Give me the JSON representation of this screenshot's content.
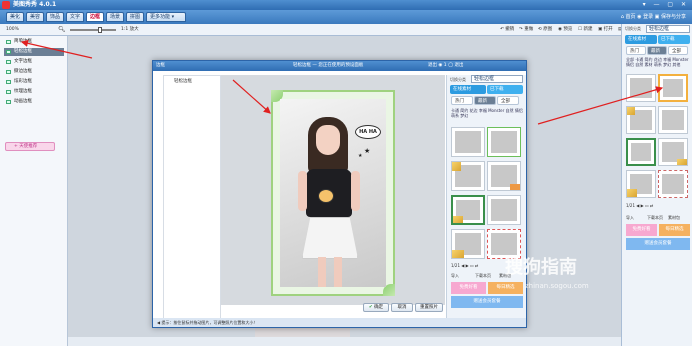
{
  "app": {
    "title": "美图秀秀 4.0.1",
    "window_controls": "▾ — ▢ ✕"
  },
  "menu": {
    "tabs": [
      "美化",
      "美容",
      "饰品",
      "文字",
      "边框",
      "场景",
      "拼图",
      "更多功能 ▾"
    ],
    "active_tab_index": 4,
    "right": "⌂ 首页   ◉ 登录  ▣ 保存与分享"
  },
  "toolbar": {
    "left_label": "100%",
    "zoom_label": "1:1  放大",
    "right_items": [
      "↶ 撤销",
      "↷ 重做",
      "⟲ 原图",
      "◉ 预览",
      "☐ 新建",
      "▣ 打开",
      "▤ 保存"
    ]
  },
  "sidebar": {
    "items": [
      "简单边框",
      "轻松边框",
      "文字边框",
      "撕边边框",
      "炫彩边框",
      "纹理边框",
      "动画边框"
    ],
    "active_index": 1,
    "recommend": "+ 天使推荐"
  },
  "right_panel": {
    "header": "轻松边框",
    "subheader_left": "在线素材",
    "subheader_right": "已下载",
    "tabs": [
      "热门",
      "最新",
      "全部"
    ],
    "categories": [
      "全部",
      "卡通",
      "简约",
      "花边",
      "幸福",
      "Monster",
      "情侣",
      "自然",
      "素材",
      "萌系",
      "梦幻",
      "其他"
    ],
    "page": "1/21",
    "bottom_buttons": [
      "导入",
      "下载本页",
      "素材包"
    ],
    "banners": [
      "免费好看",
      "每日精选",
      "赠送会员套餐"
    ]
  },
  "dialog": {
    "icon_label": "边框",
    "title": "轻松边框 — 您正在使用的预设面板",
    "title_right": "退出  ◉ 1  ◯ 退出",
    "list_item": "轻松边框",
    "right_header": "轻松边框",
    "right_sub_left": "在线素材",
    "right_sub_right": "已下载",
    "right_tabs": [
      "热门",
      "最新",
      "全部"
    ],
    "page": "1/21",
    "banners": [
      "免费好看",
      "每日精选",
      "赠送会员套餐"
    ],
    "bottom_buttons": [
      "导入",
      "下载本页",
      "素材包"
    ],
    "status": "◀ 提示：按住鼠标并拖动图片，可调整照片位置和大小！",
    "ok_label": "确定",
    "cancel_label": "取消",
    "reset_label": "重置照片"
  },
  "photo": {
    "speech_bubble": "HA HA"
  },
  "watermark": {
    "main": "搜狗指南",
    "sub": "zhinan.sogou.com"
  },
  "colors": {
    "accent": "#2f6db3",
    "frame_green": "#9fd27f",
    "pink": "#f7a8d0",
    "orange": "#f5b160"
  }
}
